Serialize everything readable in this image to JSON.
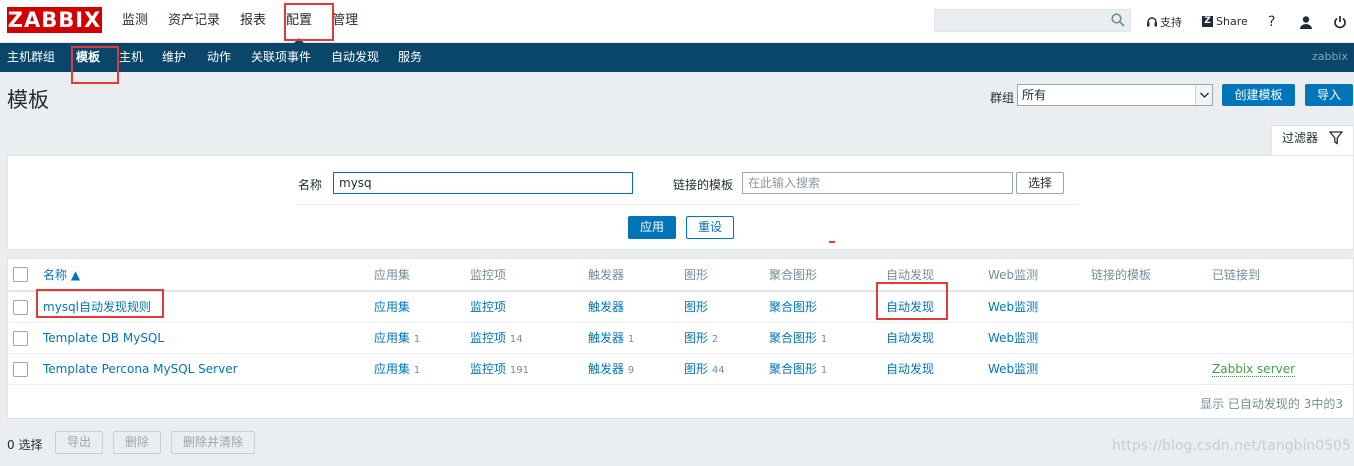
{
  "header": {
    "logo": "ZABBIX",
    "nav": [
      "监测",
      "资产记录",
      "报表",
      "配置",
      "管理"
    ],
    "active_nav": "配置",
    "support": "支持",
    "share": "Share",
    "help": "?"
  },
  "subnav": {
    "items": [
      "主机群组",
      "模板",
      "主机",
      "维护",
      "动作",
      "关联项事件",
      "自动发现",
      "服务"
    ],
    "active": "模板",
    "user": "zabbix"
  },
  "page": {
    "title": "模板",
    "group_label": "群组",
    "group_value": "所有",
    "create_button": "创建模板",
    "import_button": "导入"
  },
  "filter": {
    "tab_label": "过滤器",
    "name_label": "名称",
    "name_value": "mysq",
    "linked_label": "链接的模板",
    "linked_placeholder": "在此输入搜索",
    "select_button": "选择",
    "apply_button": "应用",
    "reset_button": "重设"
  },
  "table": {
    "columns": [
      "名称 ▲",
      "应用集",
      "监控项",
      "触发器",
      "图形",
      "聚合图形",
      "自动发现",
      "Web监测",
      "链接的模板",
      "已链接到"
    ],
    "rows": [
      {
        "name": "mysql自动发现规则",
        "apps": "应用集",
        "apps_n": "",
        "items": "监控项",
        "items_n": "",
        "triggers": "触发器",
        "triggers_n": "",
        "graphs": "图形",
        "graphs_n": "",
        "screens": "聚合图形",
        "screens_n": "",
        "discovery": "自动发现",
        "web": "Web监测",
        "linked": ""
      },
      {
        "name": "Template DB MySQL",
        "apps": "应用集",
        "apps_n": "1",
        "items": "监控项",
        "items_n": "14",
        "triggers": "触发器",
        "triggers_n": "1",
        "graphs": "图形",
        "graphs_n": "2",
        "screens": "聚合图形",
        "screens_n": "1",
        "discovery": "自动发现",
        "web": "Web监测",
        "linked": ""
      },
      {
        "name": "Template Percona MySQL Server",
        "apps": "应用集",
        "apps_n": "1",
        "items": "监控项",
        "items_n": "191",
        "triggers": "触发器",
        "triggers_n": "9",
        "graphs": "图形",
        "graphs_n": "44",
        "screens": "聚合图形",
        "screens_n": "1",
        "discovery": "自动发现",
        "web": "Web监测",
        "linked": "Zabbix server"
      }
    ],
    "footer": "显示 已自动发现的 3中的3"
  },
  "actions": {
    "selected": "0 选择",
    "export": "导出",
    "delete": "删除",
    "delete_clear": "删除并清除"
  },
  "watermark": "https://blog.csdn.net/tangbin0505",
  "colors": {
    "logo": "#d40000",
    "subnav": "#0a466a",
    "link": "#0275b8",
    "highlight": "#e53935"
  }
}
